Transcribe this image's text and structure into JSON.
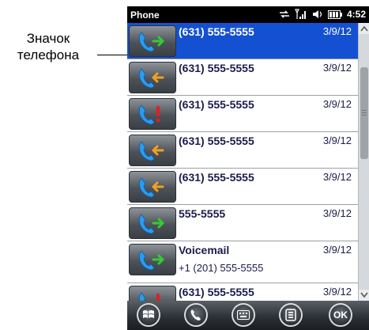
{
  "annotation": {
    "label_line1": "Значок",
    "label_line2": "телефона"
  },
  "status_bar": {
    "title": "Phone",
    "time": "4:52",
    "icons": [
      "sync-icon",
      "signal-icon",
      "speaker-icon",
      "battery-icon"
    ]
  },
  "call_log": [
    {
      "name": "(631) 555-5555",
      "date": "3/9/12",
      "type": "outgoing",
      "selected": true
    },
    {
      "name": "(631) 555-5555",
      "date": "3/9/12",
      "type": "incoming",
      "selected": false
    },
    {
      "name": "(631) 555-5555",
      "date": "3/9/12",
      "type": "missed",
      "selected": false
    },
    {
      "name": "(631) 555-5555",
      "date": "3/9/12",
      "type": "incoming",
      "selected": false
    },
    {
      "name": "(631) 555-5555",
      "date": "3/9/12",
      "type": "incoming",
      "selected": false
    },
    {
      "name": "555-5555",
      "date": "3/9/12",
      "type": "outgoing",
      "selected": false
    },
    {
      "name": "Voicemail",
      "sub": "+1 (201) 555-5555",
      "date": "3/9/12",
      "type": "outgoing",
      "selected": false
    },
    {
      "name": "(631) 555-5555",
      "date": "3/9/12",
      "type": "missed",
      "selected": false
    }
  ],
  "softkeys": {
    "start": "windows-start-icon",
    "phone": "phone-icon",
    "keyboard": "keyboard-icon",
    "menu": "menu-icon",
    "ok_label": "OK"
  },
  "colors": {
    "selected_row": "#1450d2",
    "outgoing_arrow": "#33cc33",
    "incoming_arrow": "#f0a020",
    "missed_mark": "#e02020",
    "handset": "#2a9cf0"
  }
}
